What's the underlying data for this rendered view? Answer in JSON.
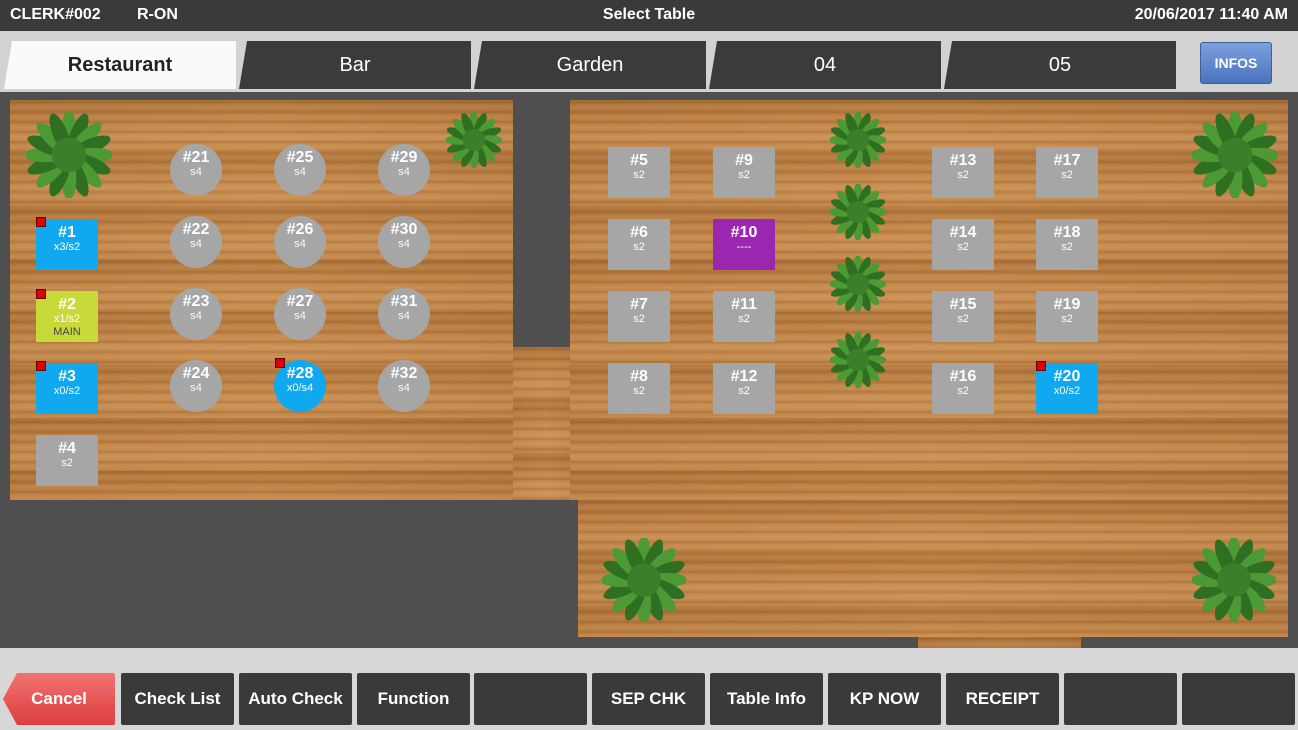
{
  "header": {
    "clerk": "CLERK#002",
    "mode": "R-ON",
    "title": "Select Table",
    "datetime": "20/06/2017 11:40 AM"
  },
  "tabs": [
    {
      "label": "Restaurant",
      "active": true
    },
    {
      "label": "Bar"
    },
    {
      "label": "Garden"
    },
    {
      "label": "04"
    },
    {
      "label": "05"
    }
  ],
  "infos_label": "INFOS",
  "tables": [
    {
      "num": "#1",
      "sub": "x3/s2",
      "color": "#10a8ee",
      "marker": true
    },
    {
      "num": "#2",
      "sub": "x1/s2",
      "extra": "MAIN",
      "color": "#c9d93a",
      "marker": true
    },
    {
      "num": "#3",
      "sub": "x0/s2",
      "color": "#10a8ee",
      "marker": true
    },
    {
      "num": "#4",
      "sub": "s2",
      "color": "#a6a6a6"
    },
    {
      "num": "#21",
      "sub": "s4",
      "color": "#a6a6a6",
      "shape": "round"
    },
    {
      "num": "#22",
      "sub": "s4",
      "color": "#a6a6a6",
      "shape": "round"
    },
    {
      "num": "#23",
      "sub": "s4",
      "color": "#a6a6a6",
      "shape": "round"
    },
    {
      "num": "#24",
      "sub": "s4",
      "color": "#a6a6a6",
      "shape": "round"
    },
    {
      "num": "#25",
      "sub": "s4",
      "color": "#a6a6a6",
      "shape": "round"
    },
    {
      "num": "#26",
      "sub": "s4",
      "color": "#a6a6a6",
      "shape": "round"
    },
    {
      "num": "#27",
      "sub": "s4",
      "color": "#a6a6a6",
      "shape": "round"
    },
    {
      "num": "#28",
      "sub": "x0/s4",
      "color": "#10a8ee",
      "shape": "round",
      "marker": true
    },
    {
      "num": "#29",
      "sub": "s4",
      "color": "#a6a6a6",
      "shape": "round"
    },
    {
      "num": "#30",
      "sub": "s4",
      "color": "#a6a6a6",
      "shape": "round"
    },
    {
      "num": "#31",
      "sub": "s4",
      "color": "#a6a6a6",
      "shape": "round"
    },
    {
      "num": "#32",
      "sub": "s4",
      "color": "#a6a6a6",
      "shape": "round"
    },
    {
      "num": "#5",
      "sub": "s2",
      "color": "#a6a6a6"
    },
    {
      "num": "#6",
      "sub": "s2",
      "color": "#a6a6a6"
    },
    {
      "num": "#7",
      "sub": "s2",
      "color": "#a6a6a6"
    },
    {
      "num": "#8",
      "sub": "s2",
      "color": "#a6a6a6"
    },
    {
      "num": "#9",
      "sub": "s2",
      "color": "#a6a6a6"
    },
    {
      "num": "#10",
      "sub": "----",
      "color": "#9b27b0"
    },
    {
      "num": "#11",
      "sub": "s2",
      "color": "#a6a6a6"
    },
    {
      "num": "#12",
      "sub": "s2",
      "color": "#a6a6a6"
    },
    {
      "num": "#13",
      "sub": "s2",
      "color": "#a6a6a6"
    },
    {
      "num": "#14",
      "sub": "s2",
      "color": "#a6a6a6"
    },
    {
      "num": "#15",
      "sub": "s2",
      "color": "#a6a6a6"
    },
    {
      "num": "#16",
      "sub": "s2",
      "color": "#a6a6a6"
    },
    {
      "num": "#17",
      "sub": "s2",
      "color": "#a6a6a6"
    },
    {
      "num": "#18",
      "sub": "s2",
      "color": "#a6a6a6"
    },
    {
      "num": "#19",
      "sub": "s2",
      "color": "#a6a6a6"
    },
    {
      "num": "#20",
      "sub": "x0/s2",
      "color": "#10a8ee",
      "marker": true
    }
  ],
  "buttons": [
    {
      "label": "Cancel",
      "type": "cancel"
    },
    {
      "label": "Check List"
    },
    {
      "label": "Auto Check"
    },
    {
      "label": "Function"
    },
    {
      "label": ""
    },
    {
      "label": "SEP CHK"
    },
    {
      "label": "Table Info"
    },
    {
      "label": "KP NOW"
    },
    {
      "label": "RECEIPT"
    },
    {
      "label": ""
    },
    {
      "label": ""
    }
  ],
  "colors": {
    "table_default": "#a6a6a6",
    "table_occupied": "#10a8ee",
    "table_main": "#c9d93a",
    "table_reserved": "#9b27b0",
    "marker": "#e00000",
    "cancel": "#e24a4a",
    "plant": "#3f8a2c"
  },
  "icons": {
    "plant": "plant-icon",
    "marker": "order-flag-icon"
  }
}
